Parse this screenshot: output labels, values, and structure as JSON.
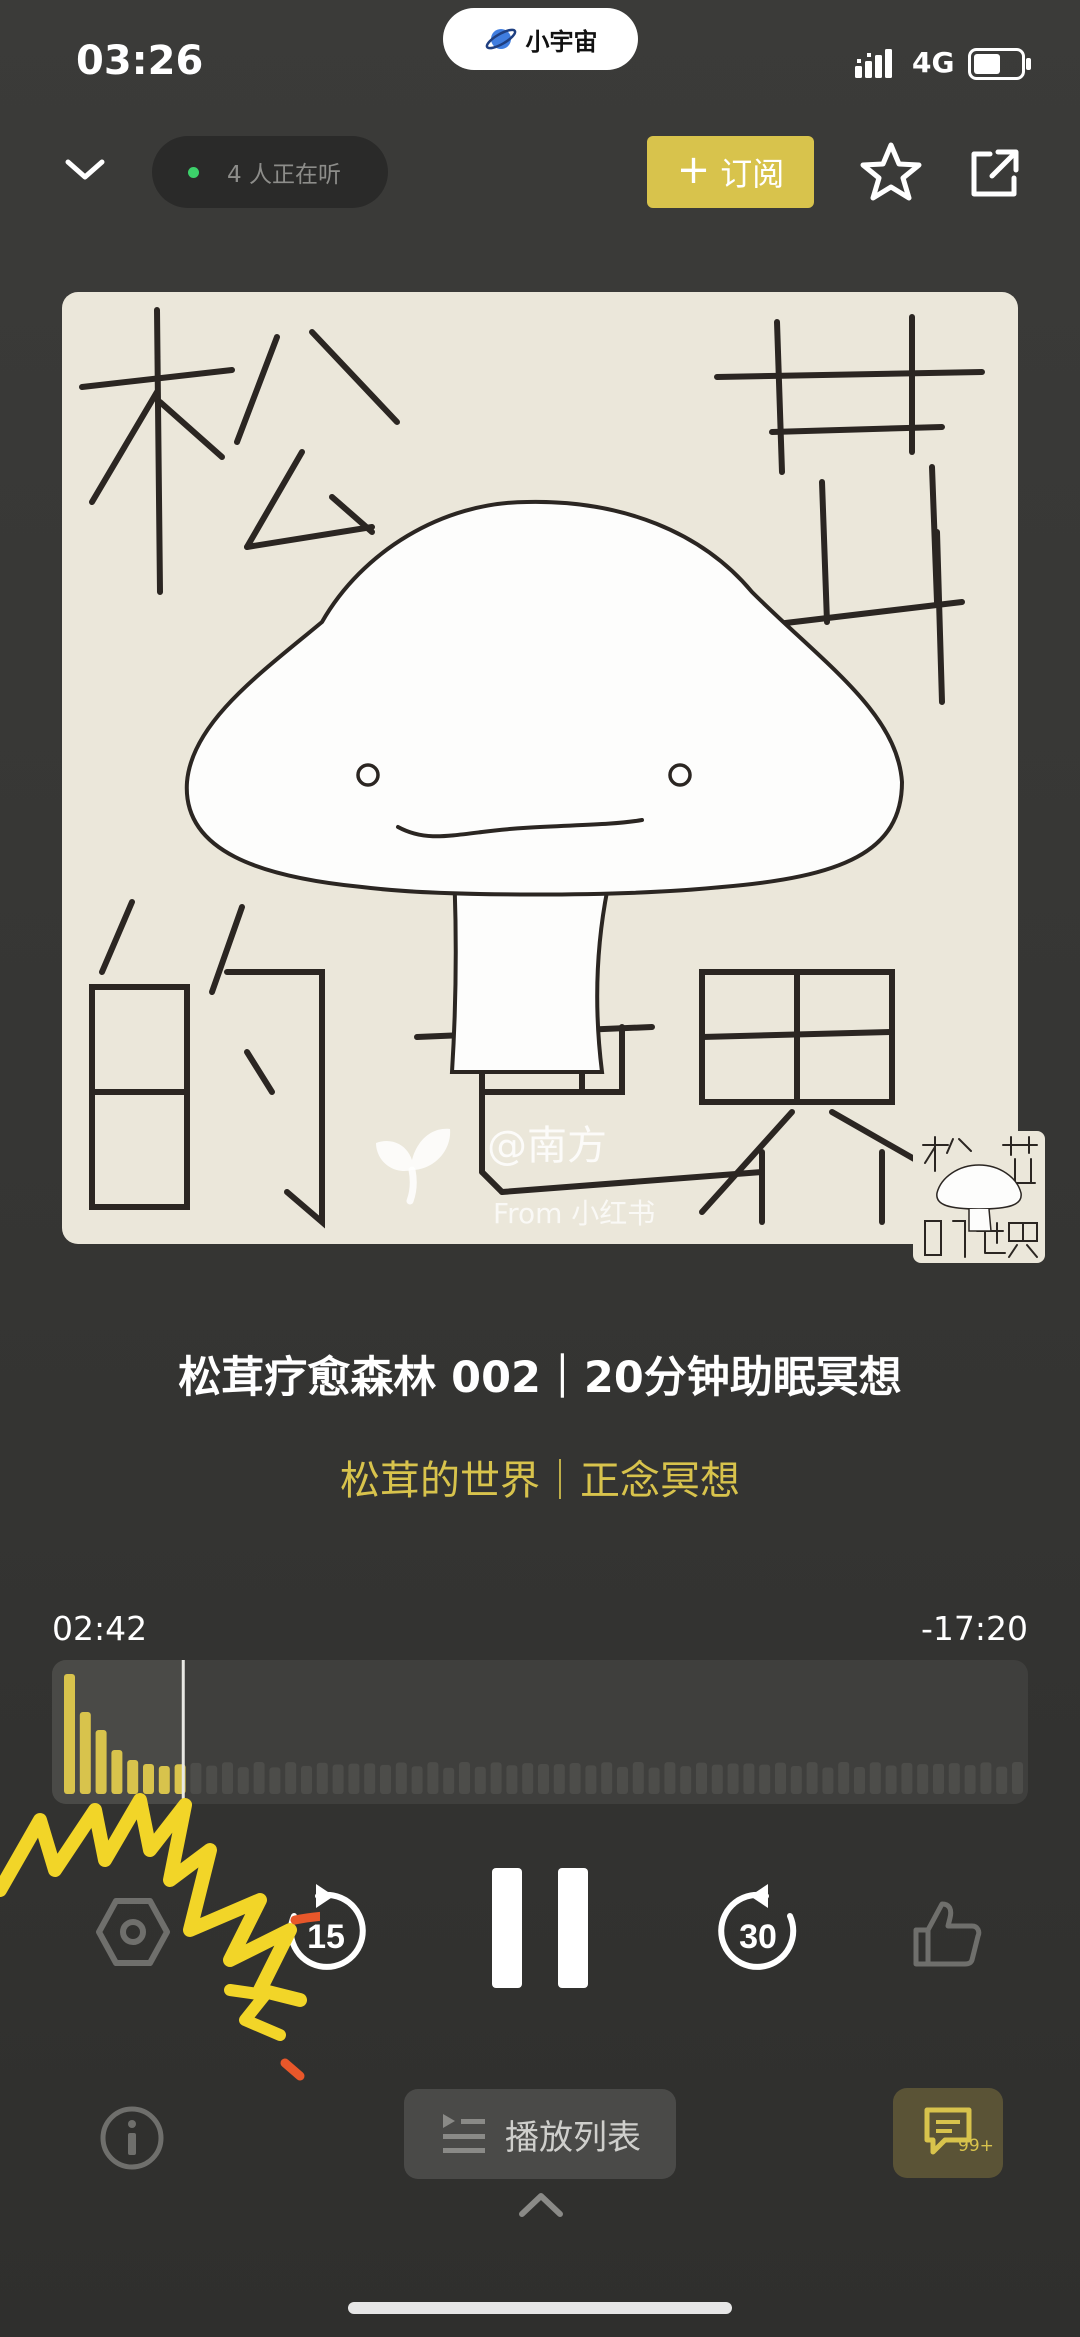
{
  "status_bar": {
    "time": "03:26",
    "app_pill": "小宇宙",
    "network": "4G"
  },
  "top_bar": {
    "listening_count": "4 人正在听",
    "subscribe_label": "订阅"
  },
  "cover": {
    "artwork_text": [
      "松",
      "茸",
      "的",
      "世",
      "界"
    ],
    "watermark_handle": "@南方",
    "watermark_from": "From 小红书"
  },
  "episode": {
    "title": "松茸疗愈森林 002｜20分钟助眠冥想",
    "subtitle": "松茸的世界｜正念冥想"
  },
  "progress": {
    "elapsed": "02:42",
    "remaining": "-17:20",
    "played_fraction": 0.135
  },
  "controls": {
    "rewind_seconds": "15",
    "forward_seconds": "30"
  },
  "bottom": {
    "playlist_label": "播放列表",
    "comment_badge": "99+"
  },
  "colors": {
    "accent": "#d8c34c",
    "background": "#353533",
    "live_dot": "#3cd16a"
  }
}
